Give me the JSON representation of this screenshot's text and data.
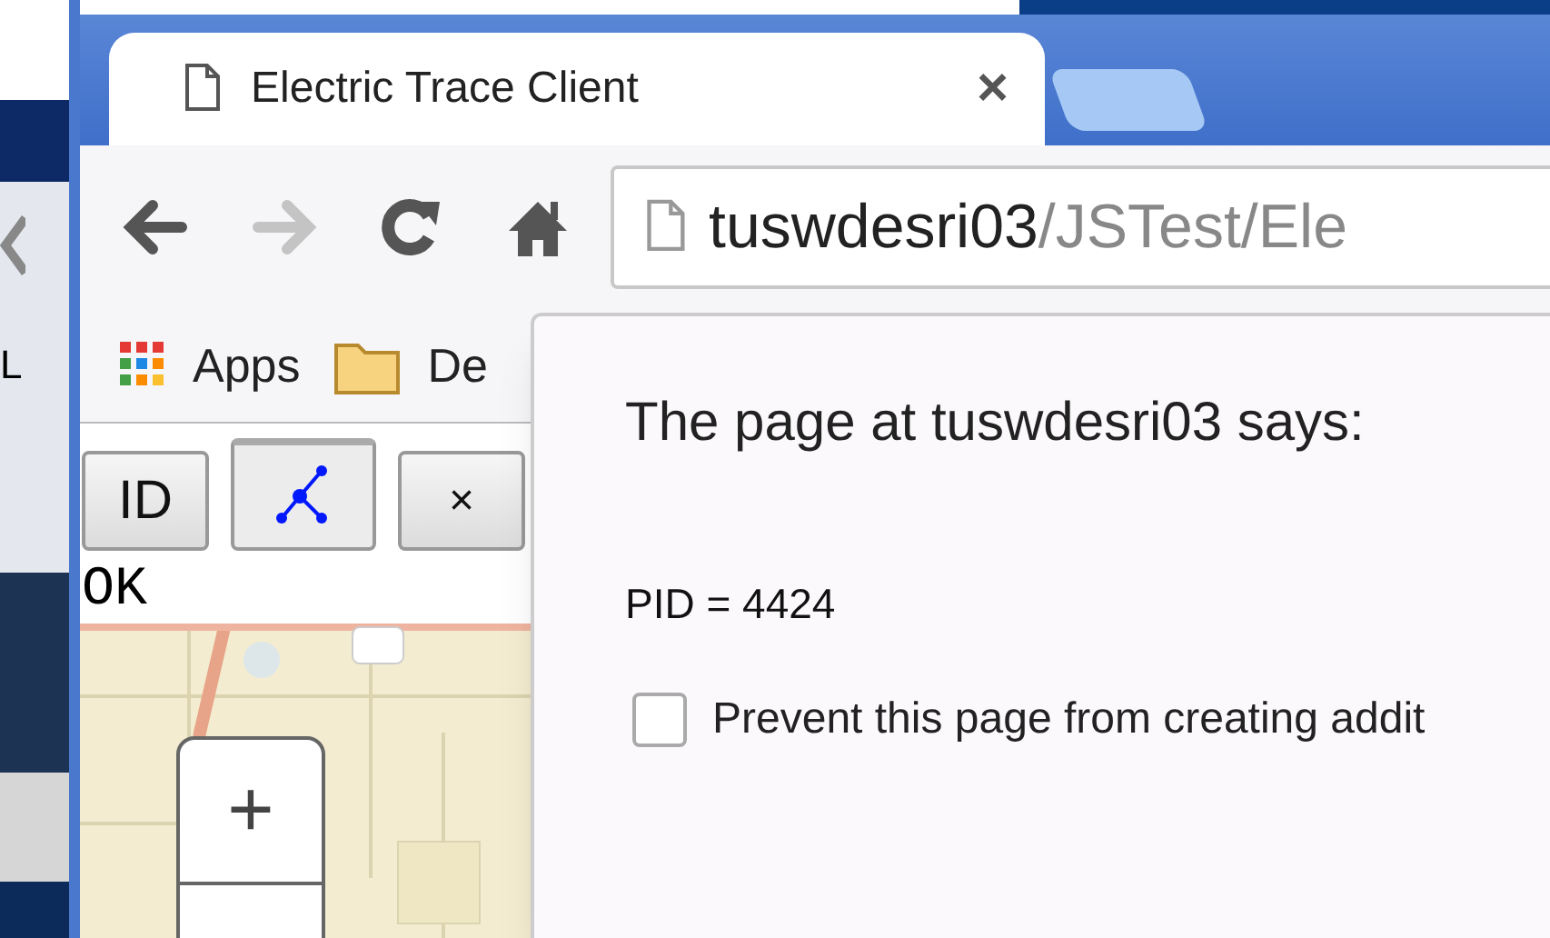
{
  "tab": {
    "title": "Electric Trace Client",
    "close": "×"
  },
  "toolbar": {
    "forward_disabled": true,
    "url_host": "tuswdesri03",
    "url_path": "/JSTest/Ele"
  },
  "bookmarks": [
    {
      "kind": "apps",
      "label": "Apps"
    },
    {
      "kind": "folder",
      "label": "De"
    }
  ],
  "page": {
    "tools": [
      {
        "kind": "text",
        "label": "ID",
        "selected": false
      },
      {
        "kind": "trace",
        "selected": true
      },
      {
        "kind": "text",
        "label": "×",
        "selected": false
      }
    ],
    "status": "OK",
    "map": {
      "zoom_in": "+"
    }
  },
  "dialog": {
    "title": "The page at tuswdesri03 says:",
    "message": "PID = 4424",
    "checkbox": {
      "label": "Prevent this page from creating addit",
      "checked": false
    }
  },
  "desktop": {
    "fragment": "L"
  }
}
